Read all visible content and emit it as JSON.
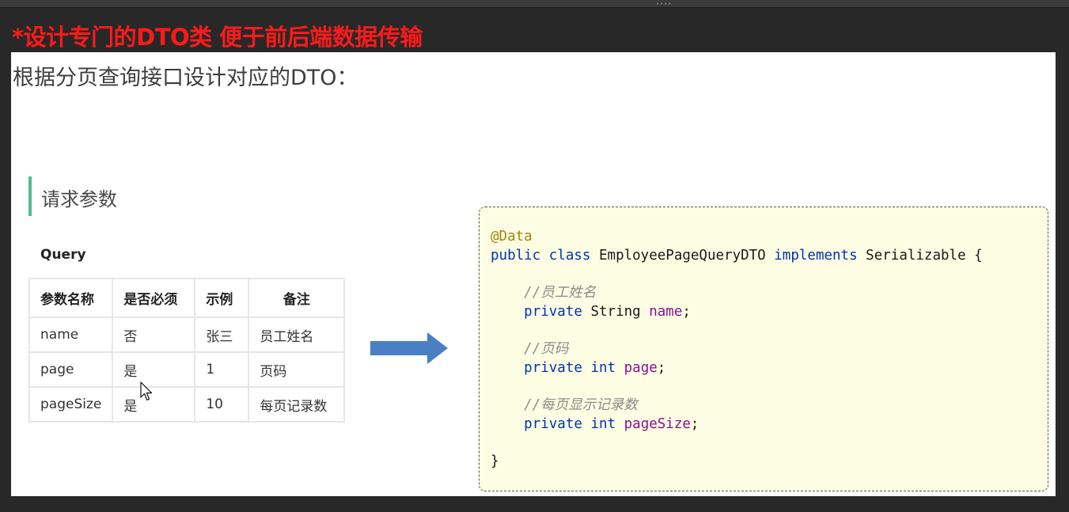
{
  "headline": "*设计专门的DTO类 便于前后端数据传输",
  "slide": {
    "title": "根据分页查询接口设计对应的DTO：",
    "section_title": "请求参数",
    "query_label": "Query",
    "table": {
      "headers": [
        "参数名称",
        "是否必须",
        "示例",
        "备注"
      ],
      "rows": [
        [
          "name",
          "否",
          "张三",
          "员工姓名"
        ],
        [
          "page",
          "是",
          "1",
          "页码"
        ],
        [
          "pageSize",
          "是",
          "10",
          "每页记录数"
        ]
      ]
    },
    "code": {
      "annotation": "@Data",
      "kw_public": "public",
      "kw_class": "class",
      "class_name": "EmployeePageQueryDTO",
      "kw_implements": "implements",
      "interface_name": "Serializable",
      "open_brace": "{",
      "close_brace": "}",
      "kw_private": "private",
      "fields": [
        {
          "comment": "//员工姓名",
          "type": "String",
          "type_is_keyword": false,
          "name": "name"
        },
        {
          "comment": "//页码",
          "type": "int",
          "type_is_keyword": true,
          "name": "page"
        },
        {
          "comment": "//每页显示记录数",
          "type": "int",
          "type_is_keyword": true,
          "name": "pageSize"
        }
      ]
    }
  },
  "colors": {
    "headline": "#ff1a1a",
    "section_accent": "#4cbf8f",
    "arrow": "#4a7fc4",
    "code_background": "#fdfde3",
    "keyword": "#0033b3",
    "field": "#871094",
    "annotation": "#9e880d"
  },
  "icons": [
    "right-arrow-icon",
    "mouse-cursor-icon",
    "window-grip-icon"
  ]
}
